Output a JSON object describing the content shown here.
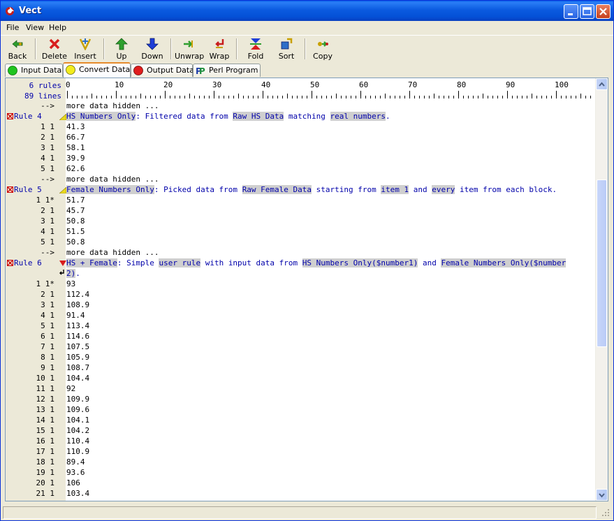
{
  "window": {
    "title": "Vect"
  },
  "menu": [
    "File",
    "View",
    "Help"
  ],
  "toolbar": [
    {
      "label": "Back",
      "icon": "back-icon"
    },
    {
      "label": "Delete",
      "icon": "delete-icon"
    },
    {
      "label": "Insert",
      "icon": "insert-icon"
    },
    {
      "label": "Up",
      "icon": "up-arrow-icon"
    },
    {
      "label": "Down",
      "icon": "down-arrow-icon"
    },
    {
      "label": "Unwrap",
      "icon": "unwrap-icon"
    },
    {
      "label": "Wrap",
      "icon": "wrap-icon"
    },
    {
      "label": "Fold",
      "icon": "fold-icon"
    },
    {
      "label": "Sort",
      "icon": "sort-icon"
    },
    {
      "label": "Copy",
      "icon": "copy-icon"
    }
  ],
  "tabs": [
    {
      "label": "Input Data",
      "icon": "green-circle-icon"
    },
    {
      "label": "Convert Data",
      "icon": "yellow-circle-icon",
      "active": true
    },
    {
      "label": "Output Data",
      "icon": "red-circle-icon"
    },
    {
      "label": "Perl Program",
      "icon": "perl-icon"
    }
  ],
  "ruler": {
    "rules_count": "6 rules",
    "lines_count": "89 lines",
    "marks": [
      "0",
      "10",
      "20",
      "30",
      "40",
      "50",
      "60",
      "70",
      "80",
      "90",
      "100"
    ]
  },
  "lines": [
    {
      "kind": "hidden",
      "ln": "-->",
      "text": "more data hidden ..."
    },
    {
      "kind": "rule",
      "rule": "Rule 4",
      "segments": [
        [
          "HS Numbers Only",
          true
        ],
        [
          ": Filtered data from ",
          false
        ],
        [
          "Raw HS Data",
          true
        ],
        [
          " matching ",
          false
        ],
        [
          "real numbers",
          true
        ],
        [
          ".",
          false
        ]
      ]
    },
    {
      "kind": "data",
      "ln": "1 1",
      "text": "41.3"
    },
    {
      "kind": "data",
      "ln": "2 1",
      "text": "66.7"
    },
    {
      "kind": "data",
      "ln": "3 1",
      "text": "58.1"
    },
    {
      "kind": "data",
      "ln": "4 1",
      "text": "39.9"
    },
    {
      "kind": "data",
      "ln": "5 1",
      "text": "62.6"
    },
    {
      "kind": "hidden",
      "ln": "-->",
      "text": "more data hidden ..."
    },
    {
      "kind": "rule",
      "rule": "Rule 5",
      "segments": [
        [
          "Female Numbers Only",
          true
        ],
        [
          ": Picked data from ",
          false
        ],
        [
          "Raw Female Data",
          true
        ],
        [
          " starting from ",
          false
        ],
        [
          "item 1",
          true
        ],
        [
          " and ",
          false
        ],
        [
          "every",
          true
        ],
        [
          " item from each block.",
          false
        ]
      ]
    },
    {
      "kind": "data",
      "ln": "1 1*",
      "text": "51.7"
    },
    {
      "kind": "data",
      "ln": "2 1",
      "text": "45.7"
    },
    {
      "kind": "data",
      "ln": "3 1",
      "text": "50.8"
    },
    {
      "kind": "data",
      "ln": "4 1",
      "text": "51.5"
    },
    {
      "kind": "data",
      "ln": "5 1",
      "text": "50.8"
    },
    {
      "kind": "hidden",
      "ln": "-->",
      "text": "more data hidden ..."
    },
    {
      "kind": "rule",
      "rule": "Rule 6",
      "open": true,
      "segments": [
        [
          "HS + Female",
          true
        ],
        [
          ": Simple ",
          false
        ],
        [
          "user rule",
          true
        ],
        [
          " with input data from ",
          false
        ],
        [
          "HS Numbers Only($number1)",
          true
        ],
        [
          " and ",
          false
        ],
        [
          "Female Numbers Only($number",
          true
        ]
      ]
    },
    {
      "kind": "cont",
      "segments": [
        [
          "2)",
          true
        ],
        [
          ".",
          false
        ]
      ]
    },
    {
      "kind": "data",
      "ln": "1 1*",
      "text": "93"
    },
    {
      "kind": "data",
      "ln": "2 1",
      "text": "112.4"
    },
    {
      "kind": "data",
      "ln": "3 1",
      "text": "108.9"
    },
    {
      "kind": "data",
      "ln": "4 1",
      "text": "91.4"
    },
    {
      "kind": "data",
      "ln": "5 1",
      "text": "113.4"
    },
    {
      "kind": "data",
      "ln": "6 1",
      "text": "114.6"
    },
    {
      "kind": "data",
      "ln": "7 1",
      "text": "107.5"
    },
    {
      "kind": "data",
      "ln": "8 1",
      "text": "105.9"
    },
    {
      "kind": "data",
      "ln": "9 1",
      "text": "108.7"
    },
    {
      "kind": "data",
      "ln": "10 1",
      "text": "104.4"
    },
    {
      "kind": "data",
      "ln": "11 1",
      "text": "92"
    },
    {
      "kind": "data",
      "ln": "12 1",
      "text": "109.9"
    },
    {
      "kind": "data",
      "ln": "13 1",
      "text": "109.6"
    },
    {
      "kind": "data",
      "ln": "14 1",
      "text": "104.1"
    },
    {
      "kind": "data",
      "ln": "15 1",
      "text": "104.2"
    },
    {
      "kind": "data",
      "ln": "16 1",
      "text": "110.4"
    },
    {
      "kind": "data",
      "ln": "17 1",
      "text": "110.9"
    },
    {
      "kind": "data",
      "ln": "18 1",
      "text": "89.4"
    },
    {
      "kind": "data",
      "ln": "19 1",
      "text": "93.6"
    },
    {
      "kind": "data",
      "ln": "20 1",
      "text": "106"
    },
    {
      "kind": "data",
      "ln": "21 1",
      "text": "103.4"
    }
  ]
}
